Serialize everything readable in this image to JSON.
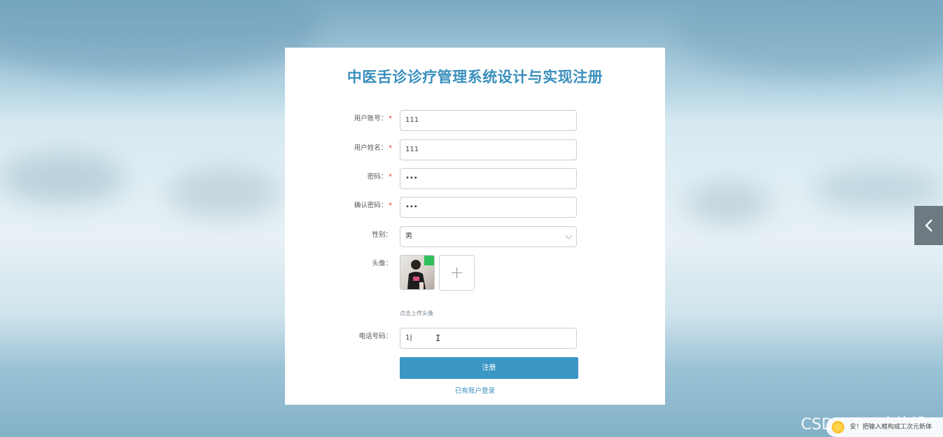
{
  "form": {
    "title": "中医舌诊诊疗管理系统设计与实现注册",
    "fields": {
      "account": {
        "label": "用户账号：",
        "required": "*",
        "value": "111"
      },
      "name": {
        "label": "用户姓名：",
        "required": "*",
        "value": "111"
      },
      "password": {
        "label": "密码：",
        "required": "*",
        "value": "•••"
      },
      "confirm": {
        "label": "确认密码：",
        "required": "*",
        "value": "•••"
      },
      "gender": {
        "label": "性别：",
        "value": "男"
      },
      "avatar": {
        "label": "头像：",
        "add_glyph": "+",
        "hint": "点击上传头像"
      },
      "phone": {
        "label": "电话号码：",
        "value": "1"
      }
    },
    "submit_label": "注册",
    "login_link": "已有账户登录"
  },
  "side_tab": {
    "icon": "chevron-left-icon"
  },
  "overlay": {
    "watermark": "CSDN @一点毕设",
    "ime_text": "安！把输入框构成工次元新体"
  },
  "colors": {
    "accent": "#3a8fbd",
    "button": "#3b97c4",
    "required": "#e23b3b"
  }
}
